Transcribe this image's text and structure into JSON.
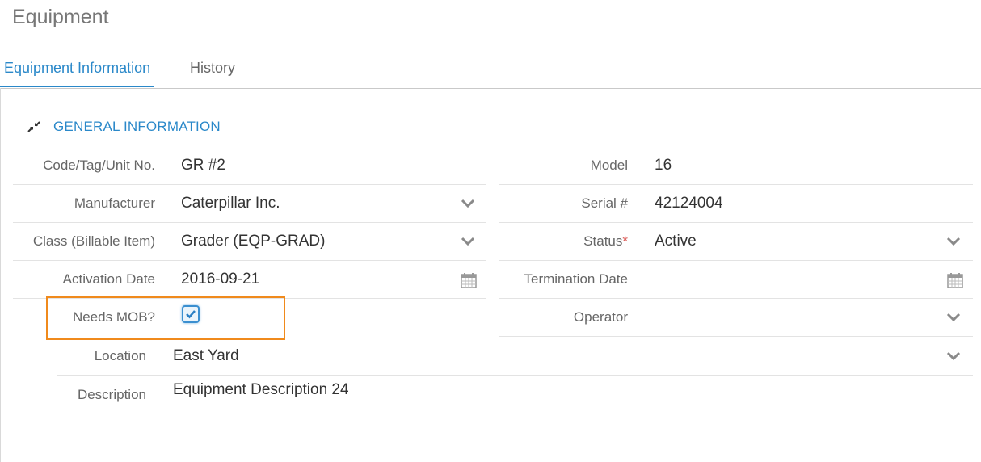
{
  "page": {
    "title": "Equipment"
  },
  "tabs": [
    {
      "label": "Equipment Information",
      "active": true
    },
    {
      "label": "History",
      "active": false
    }
  ],
  "section": {
    "title": "GENERAL INFORMATION",
    "icon": "collapse-arrows-icon"
  },
  "fields": {
    "code_tag": {
      "label": "Code/Tag/Unit No.",
      "value": "GR #2"
    },
    "model": {
      "label": "Model",
      "value": "16"
    },
    "manufacturer": {
      "label": "Manufacturer",
      "value": "Caterpillar Inc.",
      "icon": "chevron-down-icon"
    },
    "serial": {
      "label": "Serial #",
      "value": "42124004"
    },
    "class": {
      "label": "Class (Billable Item)",
      "value": "Grader (EQP-GRAD)",
      "icon": "chevron-down-icon"
    },
    "status": {
      "label": "Status",
      "required_mark": "*",
      "value": "Active",
      "icon": "chevron-down-icon"
    },
    "activation_date": {
      "label": "Activation Date",
      "value": "2016-09-21",
      "icon": "calendar-icon"
    },
    "termination_date": {
      "label": "Termination Date",
      "value": "",
      "icon": "calendar-icon"
    },
    "needs_mob": {
      "label": "Needs MOB?",
      "checked": true
    },
    "operator": {
      "label": "Operator",
      "value": "",
      "icon": "chevron-down-icon"
    },
    "location": {
      "label": "Location",
      "value": "East Yard",
      "icon": "chevron-down-icon"
    },
    "description": {
      "label": "Description",
      "value": "Equipment Description 24"
    }
  },
  "colors": {
    "accent": "#2a88c9",
    "highlight": "#f08a1c",
    "required": "#d9534f"
  }
}
